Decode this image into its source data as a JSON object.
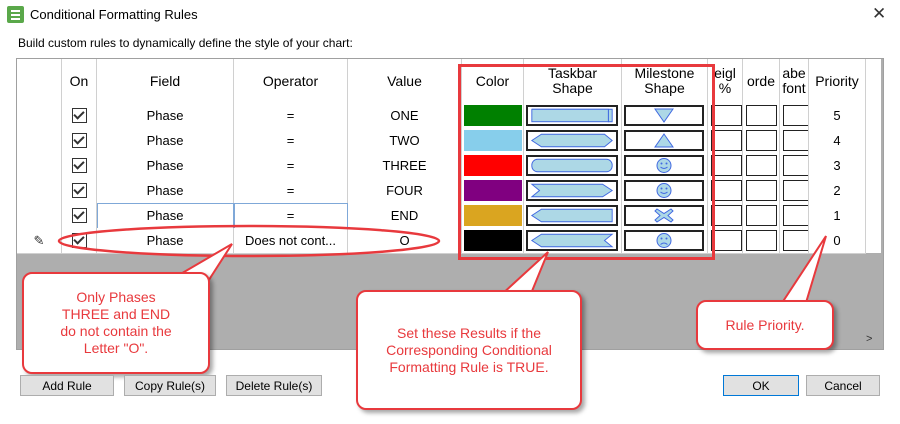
{
  "window": {
    "title": "Conditional Formatting Rules",
    "close_glyph": "✕",
    "subtitle": "Build custom rules to dynamically define the style of your chart:"
  },
  "headers": {
    "on": "On",
    "field": "Field",
    "operator": "Operator",
    "value": "Value",
    "color": "Color",
    "taskbar_shape_1": "Taskbar",
    "taskbar_shape_2": "Shape",
    "milestone_shape_1": "Milestone",
    "milestone_shape_2": "Shape",
    "weight_1": "eigl",
    "weight_2": "%",
    "border": "orde",
    "label_font_1": "abe",
    "label_font_2": "font",
    "priority": "Priority"
  },
  "rows": [
    {
      "field": "Phase",
      "operator": "=",
      "value": "ONE",
      "color": "#008000",
      "taskbar": "rect-flag",
      "milestone": "triangle-down",
      "priority": "5"
    },
    {
      "field": "Phase",
      "operator": "=",
      "value": "TWO",
      "color": "#87ceeb",
      "taskbar": "hexagon",
      "milestone": "triangle-up",
      "priority": "4"
    },
    {
      "field": "Phase",
      "operator": "=",
      "value": "THREE",
      "color": "#ff0000",
      "taskbar": "rounded",
      "milestone": "smiley",
      "priority": "3"
    },
    {
      "field": "Phase",
      "operator": "=",
      "value": "FOUR",
      "color": "#800080",
      "taskbar": "chevron",
      "milestone": "smiley",
      "priority": "2"
    },
    {
      "field": "Phase",
      "operator": "=",
      "value": "END",
      "color": "#daa520",
      "taskbar": "arrow-left",
      "milestone": "cross",
      "priority": "1"
    },
    {
      "field": "Phase",
      "operator": "Does not cont...",
      "value": "O",
      "color": "#000000",
      "taskbar": "ribbon",
      "milestone": "sad",
      "priority": "0"
    }
  ],
  "callouts": {
    "phases": "Only Phases THREE and END do not contain the Letter \"O\".",
    "results": "Set these Results if the Corresponding Conditional Formatting Rule is TRUE.",
    "priority": "Rule Priority."
  },
  "buttons": {
    "add_rule": "Add Rule",
    "copy_rules": "Copy Rule(s)",
    "delete_rules": "Delete Rule(s)",
    "ok": "OK",
    "cancel": "Cancel"
  },
  "colors": {
    "accent_red": "#e8393d",
    "shape_fill": "#add8e6",
    "shape_stroke": "#4169e1"
  }
}
